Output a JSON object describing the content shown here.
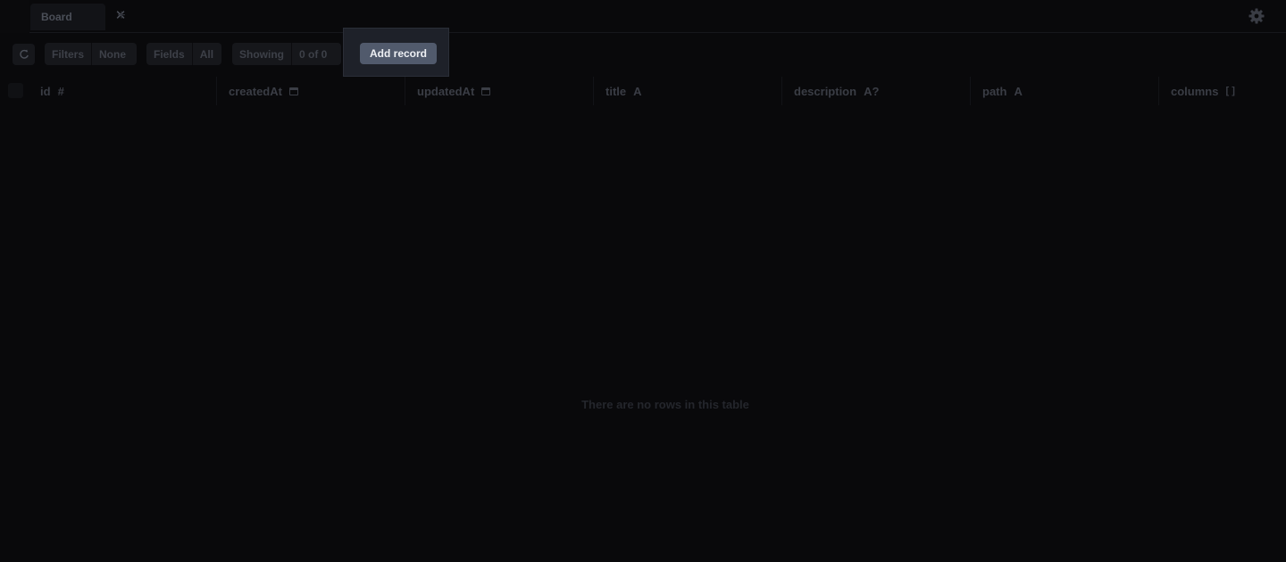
{
  "tabs": [
    {
      "label": "Board"
    }
  ],
  "toolbar": {
    "filters_label": "Filters",
    "filters_value": "None",
    "fields_label": "Fields",
    "fields_value": "All",
    "showing_label": "Showing",
    "showing_value": "0 of 0",
    "add_record_label": "Add record"
  },
  "columns": [
    {
      "name": "id",
      "type": "#"
    },
    {
      "name": "createdAt",
      "type": "calendar-icon"
    },
    {
      "name": "updatedAt",
      "type": "calendar-icon"
    },
    {
      "name": "title",
      "type": "A"
    },
    {
      "name": "description",
      "type": "A?"
    },
    {
      "name": "path",
      "type": "A"
    },
    {
      "name": "columns",
      "type": "[ ]"
    }
  ],
  "empty_message": "There are no rows in this table",
  "colors": {
    "background": "#09090b",
    "accent_button": "#515a6c",
    "muted_text": "#3a3d45"
  }
}
